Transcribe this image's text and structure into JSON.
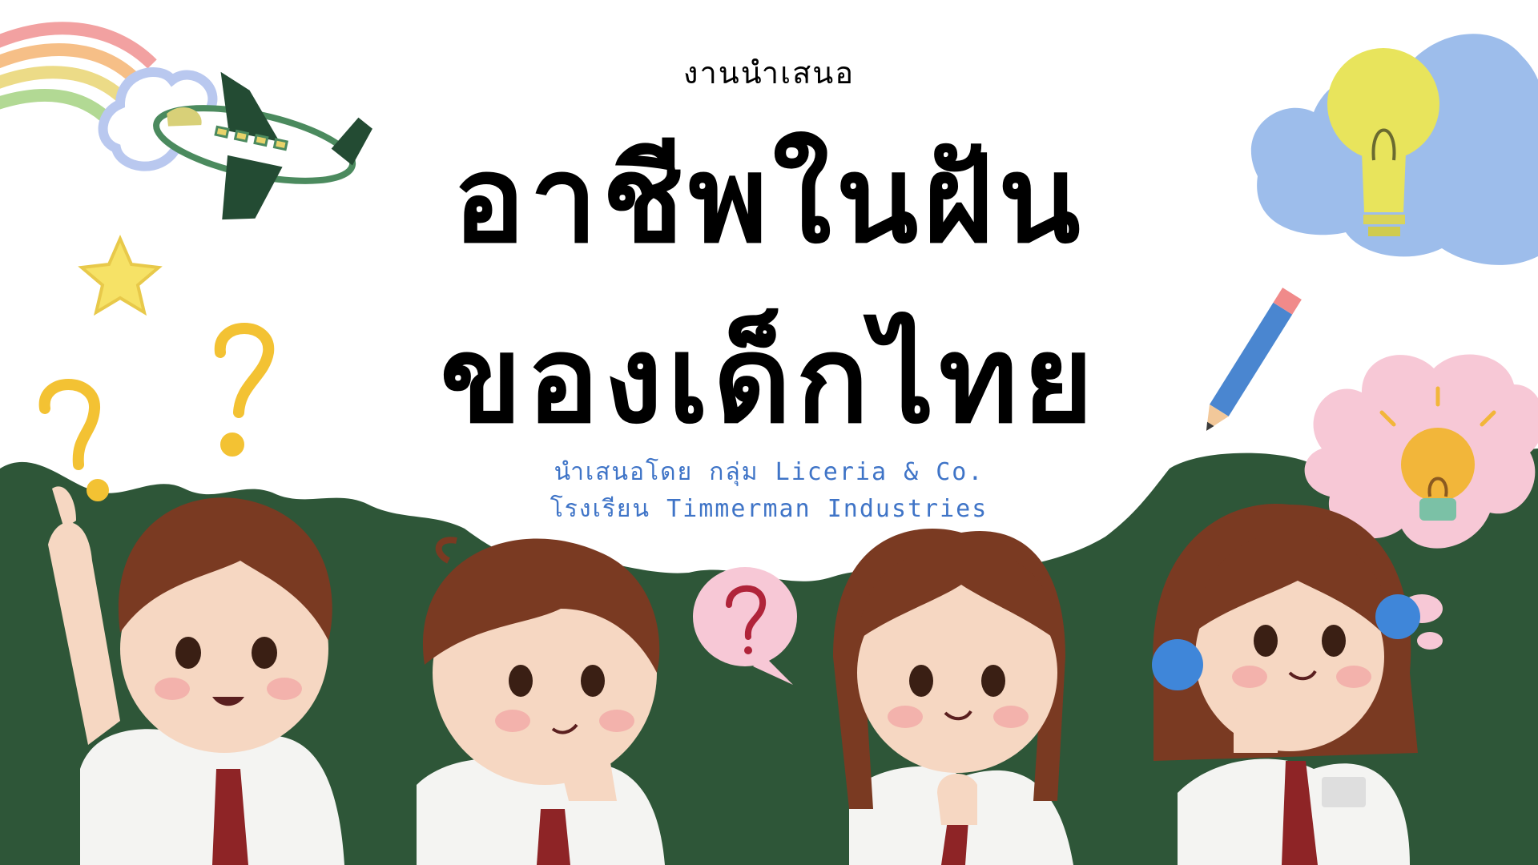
{
  "slide": {
    "kicker": "งานนำเสนอ",
    "title_line1": "อาชีพในฝัน",
    "title_line2": "ของเด็กไทย",
    "subtitle_line1": "นำเสนอโดย กลุ่ม Liceria & Co.",
    "subtitle_line2": "โรงเรียน Timmerman Industries"
  },
  "colors": {
    "chalkboard": "#2e5638",
    "subtitle": "#3f74c7",
    "tie": "#8e2426",
    "hair": "#7a3a22",
    "skin": "#f6d7c2",
    "question_yellow": "#f3c233",
    "cloud_blue": "#8cb2e8",
    "bulb_yellow": "#e8e45c",
    "thought_pink": "#f7c8d6"
  },
  "icons": {
    "decorations": [
      "rainbow-icon",
      "airplane-icon",
      "star-icon",
      "lightbulb-icon",
      "pencil-icon",
      "question-mark-icon",
      "speech-bubble-icon",
      "thought-bubble-icon"
    ]
  }
}
